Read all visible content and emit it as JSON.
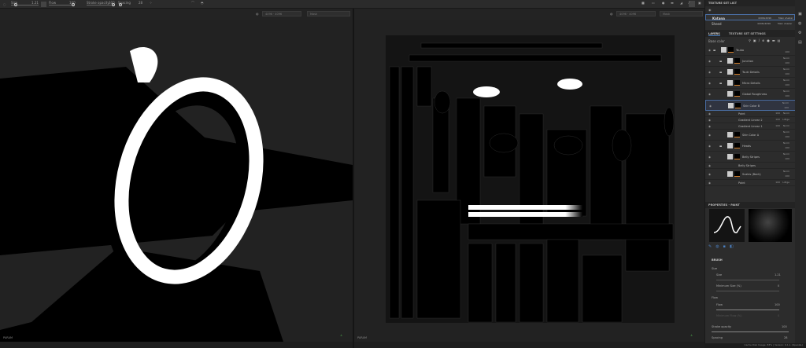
{
  "toolbar": {
    "size_label": "Size",
    "size_value": "1.21",
    "flow_label": "Flow",
    "flow_value": "100",
    "stroke_opacity_label": "Stroke opacity",
    "stroke_opacity_value": "100",
    "spacing_label": "Spacing",
    "spacing_value": "28"
  },
  "viewport_left": {
    "resolution": "4096 · 4096",
    "channel": "Mask",
    "footer": "PARAM"
  },
  "viewport_right": {
    "resolution": "4096 · 4096",
    "channel": "Mask",
    "footer": "PARAM"
  },
  "texture_set_list": {
    "title": "TEXTURE SET LIST",
    "items": [
      {
        "name": "Katana",
        "size": "4096x4096",
        "shader": "Main shader",
        "selected": true
      },
      {
        "name": "Sheed",
        "size": "4096x4096",
        "shader": "Main shader",
        "selected": false
      }
    ]
  },
  "layers": {
    "tab_layers": "LAYERS",
    "tab_settings": "TEXTURE SET SETTINGS",
    "channel": "Base color",
    "items": [
      {
        "name": "Tsuba",
        "blend": "",
        "opacity": "100",
        "indent": 0,
        "folder": true
      },
      {
        "name": "Junction",
        "blend": "Norm",
        "opacity": "100",
        "indent": 1,
        "folder": true
      },
      {
        "name": "Tsuki Details",
        "blend": "Norm",
        "opacity": "100",
        "indent": 1,
        "folder": true
      },
      {
        "name": "Micro Details",
        "blend": "Norm",
        "opacity": "100",
        "indent": 1,
        "folder": true
      },
      {
        "name": "Global Roughness",
        "blend": "Norm",
        "opacity": "100",
        "indent": 1,
        "folder": false
      },
      {
        "name": "Skin Color B",
        "blend": "Norm",
        "opacity": "100",
        "indent": 1,
        "folder": false,
        "selected": true
      },
      {
        "name": "Paint",
        "blend": "Norm",
        "opacity": "100",
        "indent": 2,
        "sub": true
      },
      {
        "name": "Gradient Linear 2",
        "blend": "LiDge",
        "opacity": "100",
        "indent": 2,
        "sub": true
      },
      {
        "name": "Gradient Linear 1",
        "blend": "Norm",
        "opacity": "100",
        "indent": 2,
        "sub": true
      },
      {
        "name": "Skin Color A",
        "blend": "Norm",
        "opacity": "100",
        "indent": 1,
        "folder": false
      },
      {
        "name": "Heads",
        "blend": "Norm",
        "opacity": "100",
        "indent": 1,
        "folder": true
      },
      {
        "name": "Belly Stripes",
        "blend": "Norm",
        "opacity": "100",
        "indent": 1,
        "folder": false
      },
      {
        "name": "Belly Stripes",
        "blend": "",
        "opacity": "",
        "indent": 2,
        "sub": true
      },
      {
        "name": "Scales (Back)",
        "blend": "Norm",
        "opacity": "100",
        "indent": 1,
        "folder": false
      },
      {
        "name": "Paint",
        "blend": "LiDge",
        "opacity": "100",
        "indent": 2,
        "sub": true
      }
    ]
  },
  "properties": {
    "title": "PROPERTIES - PAINT",
    "section": "BRUSH",
    "group_size": "Size",
    "size_label": "Size",
    "size_value": "1.21",
    "min_size_label": "Minimum Size (%)",
    "min_size_value": "0",
    "group_flow": "Flow",
    "flow_label": "Flow",
    "flow_value": "100",
    "min_flow_label": "Minimum Flow (%)",
    "min_flow_value": "0",
    "stroke_opacity_label": "Stroke opacity",
    "stroke_opacity_value": "100",
    "spacing_label": "Spacing",
    "spacing_value": "28"
  },
  "status": "Cache Disk Usage: 83% | Version: 9.1.1 (OpenGL)",
  "colors": {
    "accent": "#4a7fc1",
    "selection_border": "#4a6fa5",
    "mask_orange": "#d9822b"
  }
}
